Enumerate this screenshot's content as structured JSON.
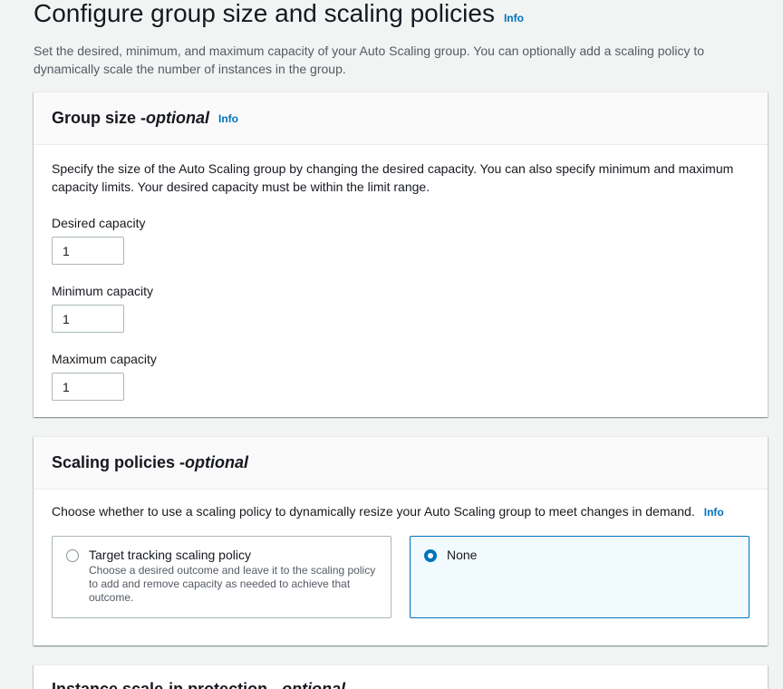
{
  "page": {
    "title": "Configure group size and scaling policies",
    "title_info": "Info",
    "description": "Set the desired, minimum, and maximum capacity of your Auto Scaling group. You can optionally add a scaling policy to dynamically scale the number of instances in the group."
  },
  "group_size": {
    "title": "Group size - ",
    "title_optional": "optional",
    "info": "Info",
    "description": "Specify the size of the Auto Scaling group by changing the desired capacity. You can also specify minimum and maximum capacity limits. Your desired capacity must be within the limit range.",
    "desired_label": "Desired capacity",
    "desired_value": "1",
    "minimum_label": "Minimum capacity",
    "minimum_value": "1",
    "maximum_label": "Maximum capacity",
    "maximum_value": "1"
  },
  "scaling_policies": {
    "title": "Scaling policies - ",
    "title_optional": "optional",
    "description": "Choose whether to use a scaling policy to dynamically resize your Auto Scaling group to meet changes in demand.",
    "info": "Info",
    "options": [
      {
        "label": "Target tracking scaling policy",
        "description": "Choose a desired outcome and leave it to the scaling policy to add and remove capacity as needed to achieve that outcome.",
        "selected": false
      },
      {
        "label": "None",
        "description": "",
        "selected": true
      }
    ]
  },
  "scale_in_protection": {
    "title": "Instance scale-in protection - ",
    "title_optional": "optional"
  },
  "colors": {
    "link": "#0073bb",
    "selected_border": "#0073bb",
    "selected_bg": "#f1faff",
    "page_bg": "#f2f3f3"
  }
}
